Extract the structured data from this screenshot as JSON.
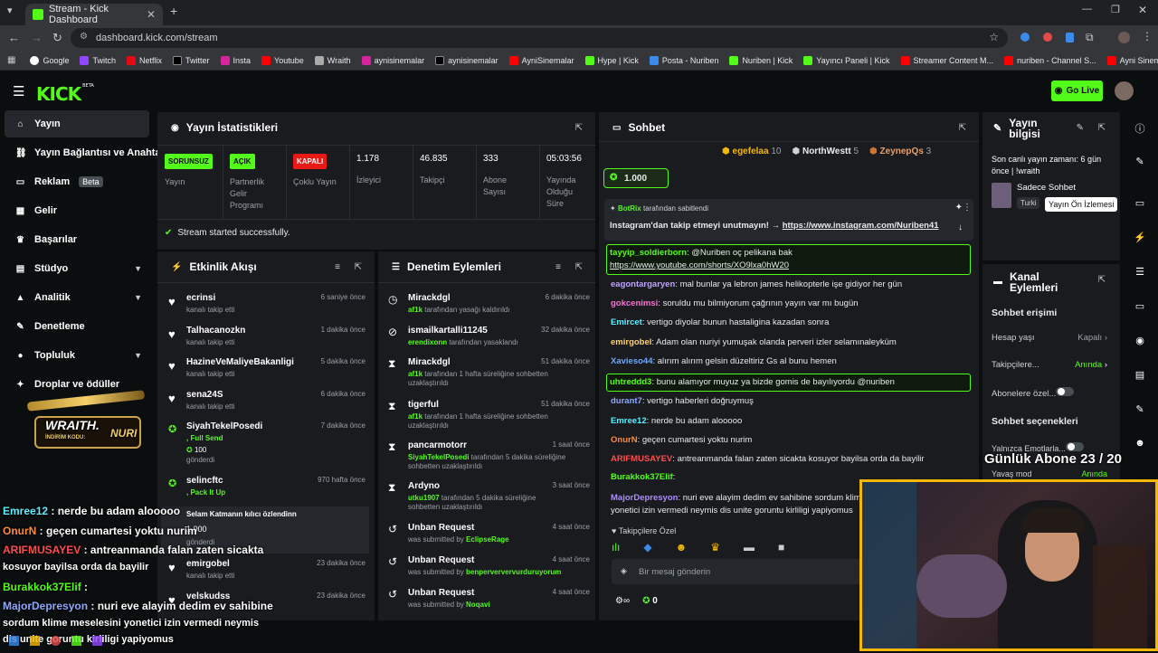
{
  "browser": {
    "tab_title": "Stream - Kick Dashboard",
    "url": "dashboard.kick.com/stream",
    "bookmarks": [
      "Google",
      "Twitch",
      "Netflix",
      "Twitter",
      "Insta",
      "Youtube",
      "Wraith",
      "aynisinemalar",
      "aynisinemalar",
      "AyniSinemalar",
      "Hype | Kick",
      "Posta - Nuriben",
      "Nuriben | Kick",
      "Yayıncı Paneli | Kick",
      "Streamer Content M...",
      "nuriben - Channel S...",
      "Ayni Sinemalar - Ça..."
    ]
  },
  "header": {
    "logo": "KICK",
    "logo_sup": "BETA",
    "go_live": "Go Live"
  },
  "sidebar": {
    "items": [
      {
        "label": "Yayın",
        "icon": "home-icon"
      },
      {
        "label": "Yayın Bağlantısı ve Anahtarı",
        "icon": "link-icon"
      },
      {
        "label": "Reklam",
        "icon": "ad-icon",
        "badge": "Beta"
      },
      {
        "label": "Gelir",
        "icon": "grid-icon"
      },
      {
        "label": "Başarılar",
        "icon": "trophy-icon"
      },
      {
        "label": "Stüdyo",
        "icon": "studio-icon"
      },
      {
        "label": "Analitik",
        "icon": "chart-icon"
      },
      {
        "label": "Denetleme",
        "icon": "wrench-icon"
      },
      {
        "label": "Topluluk",
        "icon": "community-icon"
      },
      {
        "label": "Droplar ve ödüller",
        "icon": "gift-icon"
      }
    ]
  },
  "stats": {
    "title": "Yayın İstatistikleri",
    "cols": [
      {
        "badge": "SORUNSUZ",
        "label": "Yayın",
        "color": "#53fc18"
      },
      {
        "badge": "AÇIK",
        "label": "Partnerlik Gelir Programı",
        "color": "#53fc18"
      },
      {
        "badge": "KAPALI",
        "label": "Çoklu Yayın",
        "color": "#e91916"
      },
      {
        "value": "1.178",
        "label": "İzleyici"
      },
      {
        "value": "46.835",
        "label": "Takipçi"
      },
      {
        "value": "333",
        "label": "Abone Sayısı"
      },
      {
        "value": "05:03:56",
        "label": "Yayında Olduğu Süre"
      }
    ],
    "status": "Stream started successfully."
  },
  "activity": {
    "title": "Etkinlik Akışı",
    "items": [
      {
        "name": "ecrinsi",
        "sub": "kanalı takip etti",
        "time": "6 saniye önce"
      },
      {
        "name": "Talhacanozkn",
        "sub": "kanalı takip etti",
        "time": "1 dakika önce"
      },
      {
        "name": "HazineVeMaliyeBakanligi",
        "sub": "kanalı takip etti",
        "time": "5 dakika önce"
      },
      {
        "name": "sena24S",
        "sub": "kanalı takip etti",
        "time": "6 dakika önce"
      },
      {
        "name": "SiyahTekelPosedi",
        "sub": "Full Send",
        "amount": "100",
        "sub2": "gönderdi",
        "time": "7 dakika önce"
      },
      {
        "name": "selincftc",
        "sub": "Pack It Up",
        "time": "970 hafta önce"
      },
      {
        "name": "Selam Katmanın kılıcı özlendinn",
        "sub": "",
        "amount": "1.000",
        "sub2": "gönderdi",
        "time": ""
      },
      {
        "name": "emirgobel",
        "sub": "kanalı takip etti",
        "time": "23 dakika önce"
      },
      {
        "name": "velskudss",
        "sub": "",
        "time": "23 dakika önce"
      }
    ]
  },
  "moderation": {
    "title": "Denetim Eylemleri",
    "items": [
      {
        "name": "Mirackdgl",
        "hl": "af1k",
        "rest": " tarafından yasağı kaldırıldı",
        "time": "6 dakika önce",
        "icon": "clock-icon"
      },
      {
        "name": "ismailkartalli11245",
        "hl": "erendixonn",
        "rest": " tarafından yasaklandı",
        "time": "32 dakika önce",
        "icon": "ban-icon"
      },
      {
        "name": "Mirackdgl",
        "hl": "af1k",
        "rest": " tarafından 1 hafta süreliğine sohbetten uzaklaştırıldı",
        "time": "51 dakika önce",
        "icon": "hourglass-icon"
      },
      {
        "name": "tigerful",
        "hl": "af1k",
        "rest": " tarafından 1 hafta süreliğine sohbetten uzaklaştırıldı",
        "time": "51 dakika önce",
        "icon": "hourglass-icon"
      },
      {
        "name": "pancarmotorr",
        "hl": "SiyahTekelPosedi",
        "rest": " tarafından 5 dakika süreliğine sohbetten uzaklaştırıldı",
        "time": "1 saat önce",
        "icon": "hourglass-icon"
      },
      {
        "name": "Ardyno",
        "hl": "utku1907",
        "rest": " tarafından 5 dakika süreliğine sohbetten uzaklaştırıldı",
        "time": "3 saat önce",
        "icon": "hourglass-icon"
      },
      {
        "name": "Unban Request",
        "pre": "was submitted by ",
        "hl": "EclipseRage",
        "rest": "",
        "time": "4 saat önce",
        "icon": "history-icon"
      },
      {
        "name": "Unban Request",
        "pre": "was submitted by ",
        "hl": "benperververvurduruyorum",
        "rest": "",
        "time": "4 saat önce",
        "icon": "history-icon"
      },
      {
        "name": "Unban Request",
        "pre": "was submitted by ",
        "hl": "Noqavi",
        "rest": "",
        "time": "4 saat önce",
        "icon": "history-icon"
      }
    ]
  },
  "chat": {
    "title": "Sohbet",
    "top_gifters": [
      {
        "name": "egefelaa",
        "count": "10"
      },
      {
        "name": "NorthWestt",
        "count": "5"
      },
      {
        "name": "ZeynepQs",
        "count": "3"
      }
    ],
    "kicks": "1.000",
    "pinned_by": "BotRix",
    "pinned_suffix": "tarafından sabitlendi",
    "pinned_text": "Instagram'dan takip etmeyi unutmayın! → ",
    "pinned_link": "https://www.instagram.com/Nuriben41",
    "messages": [
      {
        "user": "tayyip_soldierborn",
        "color": "#53fc18",
        "text": "@Nuriben oç pelikana bak",
        "text2": "https://www.youtube.com/shorts/XO9lxa0hW20",
        "hl": true
      },
      {
        "user": "eagontargaryen",
        "color": "#bfa5ff",
        "text": "mal bunlar ya lebron james helikopterle işe gidiyor her gün"
      },
      {
        "user": "gokcenimsi",
        "color": "#ff6ed6",
        "text": "soruldu mu bilmiyorum çağrının yayın var mı bugün"
      },
      {
        "user": "Emircet",
        "color": "#5af0ff",
        "text": "vertigo diyolar bunun hastaligina kazadan sonra"
      },
      {
        "user": "emirgobel",
        "color": "#ffd36e",
        "text": "Adam olan nuriyi yumuşak olanda perveri izler selamınaleyküm"
      },
      {
        "user": "Xavieso44",
        "color": "#6ea8ff",
        "text": "alırım alırım gelsin düzeltiriz Gs al bunu hemen"
      },
      {
        "user": "uhtreddd3",
        "color": "#53fc18",
        "text": "bunu alamıyor muyuz ya bizde gomis de bayılıyordu @nuriben",
        "hl": true
      },
      {
        "user": "durant7",
        "color": "#8fa9ff",
        "text": "vertigo haberleri doğruymuş"
      },
      {
        "user": "Emree12",
        "color": "#5af0ff",
        "text": "nerde bu adam alooooo"
      },
      {
        "user": "OnurN",
        "color": "#ff8a3d",
        "text": "geçen cumartesi yoktu nurim"
      },
      {
        "user": "ARIFMUSAYEV",
        "color": "#ff4d4d",
        "text": "antreanmanda falan zaten sicakta kosuyor bayilsa orda da bayilir"
      },
      {
        "user": "Burakkok37Elif",
        "color": "#53fc18",
        "text": ""
      },
      {
        "user": "MajorDepresyon",
        "color": "#ad8cff",
        "text": "nuri eve alayim dedim ev sahibine sordum klime meselesini",
        "text2": "yonetici izin vermedi neymis dis unite goruntu kirliligi yapiyomus"
      }
    ],
    "follower_mode": "Takipçilere Özel",
    "input_placeholder": "Bir mesaj gönderin",
    "points": "0"
  },
  "info": {
    "title": "Yayın bilgisi",
    "last_live": "Son canlı yayın zamanı: 6 gün önce | !wraith",
    "channel": "Sadece Sohbet",
    "category_short": "Turki",
    "tooltip": "Yayın Ön İzlemesi"
  },
  "actions": {
    "title": "Kanal Eylemleri",
    "section1": "Sohbet erişimi",
    "rows": [
      {
        "label": "Hesap yaşı",
        "value": "Kapalı"
      },
      {
        "label": "Takipçilere...",
        "value": "Anında"
      },
      {
        "label": "Abonelere özel...",
        "value": ""
      }
    ],
    "section2": "Sohbet seçenekleri",
    "rows2": [
      {
        "label": "Yalnızca Emotlarla...",
        "value": ""
      },
      {
        "label": "Yavaş mod",
        "value": "Anında"
      }
    ]
  },
  "overlay": {
    "sub_goal": "Günlük Abone 23 / 20",
    "sponsor": "WRAITH.",
    "sponsor_code_label": "İNDİRİM KODU:",
    "sponsor_code": "NURI",
    "chat": [
      {
        "user": "Emree12",
        "color": "#5af0ff",
        "text": " : nerde bu adam alooooo"
      },
      {
        "user": "OnurN",
        "color": "#ff8a3d",
        "text": " : geçen cumartesi yoktu nurim"
      },
      {
        "user": "ARIFMUSAYEV",
        "color": "#ff4d4d",
        "text": " : antreanmanda falan zaten sicakta"
      },
      {
        "user": "",
        "color": "#fff",
        "text": "kosuyor bayilsa orda da bayilir"
      },
      {
        "user": "Burakkok37Elif",
        "color": "#53fc18",
        "text": " :"
      },
      {
        "user": "MajorDepresyon",
        "color": "#8fa9ff",
        "text": " : nuri eve alayim dedim ev sahibine"
      },
      {
        "user": "",
        "color": "#fff",
        "text": "sordum klime meselesini yonetici izin vermedi neymis"
      },
      {
        "user": "",
        "color": "#fff",
        "text": "dis unite goruntu kirliligi yapiyomus"
      }
    ]
  }
}
